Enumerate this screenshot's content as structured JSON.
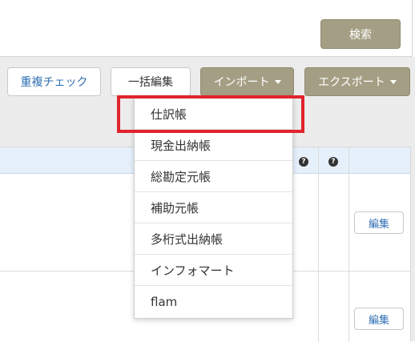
{
  "search": {
    "button_label": "検索"
  },
  "toolbar": {
    "duplicate_check_label": "重複チェック",
    "bulk_edit_label": "一括編集",
    "import_label": "インポート",
    "export_label": "エクスポート"
  },
  "table": {
    "header_icons": [
      "question-circle-icon",
      "question-circle-icon"
    ],
    "help_glyph": "?",
    "rows": [
      {
        "edit_label": "編集"
      },
      {
        "edit_label": "編集"
      }
    ]
  },
  "import_menu": {
    "items": [
      {
        "label": "仕訳帳",
        "highlighted": true
      },
      {
        "label": "現金出納帳"
      },
      {
        "label": "総勘定元帳"
      },
      {
        "label": "補助元帳"
      },
      {
        "label": "多桁式出納帳"
      },
      {
        "label": "インフォマート"
      },
      {
        "label": "flam"
      }
    ]
  },
  "colors": {
    "olive_button": "#a49f84",
    "link_blue": "#2f6fb3",
    "highlight_red": "#e0242c",
    "table_header": "#e6f0fb"
  }
}
